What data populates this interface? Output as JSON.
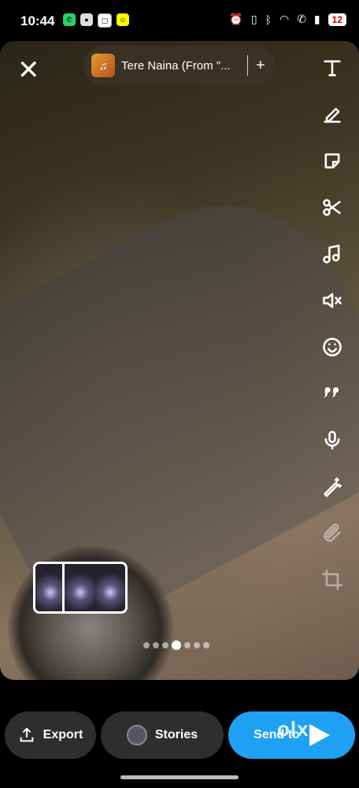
{
  "status": {
    "time": "10:44",
    "battery": "12",
    "left_icons": [
      "whatsapp-icon",
      "chat-icon",
      "app-icon",
      "snapchat-icon"
    ],
    "right_icons": [
      "alarm-icon",
      "vibrate-icon",
      "bluetooth-icon",
      "wifi-icon",
      "call-icon",
      "signal-icon"
    ]
  },
  "music": {
    "title": "Tere Naina (From \"...",
    "plus": "+"
  },
  "toolbar": {
    "items": [
      "text-tool",
      "draw-tool",
      "sticker-tool",
      "scissors-tool",
      "music-tool",
      "mute-tool",
      "emoji-tool",
      "quote-tool",
      "voice-tool",
      "magic-tool",
      "attach-tool",
      "crop-tool"
    ]
  },
  "pager": {
    "count": 7,
    "active_index": 3
  },
  "bottom": {
    "export_label": "Export",
    "stories_label": "Stories",
    "send_label": "Send to"
  },
  "watermark": "olx"
}
